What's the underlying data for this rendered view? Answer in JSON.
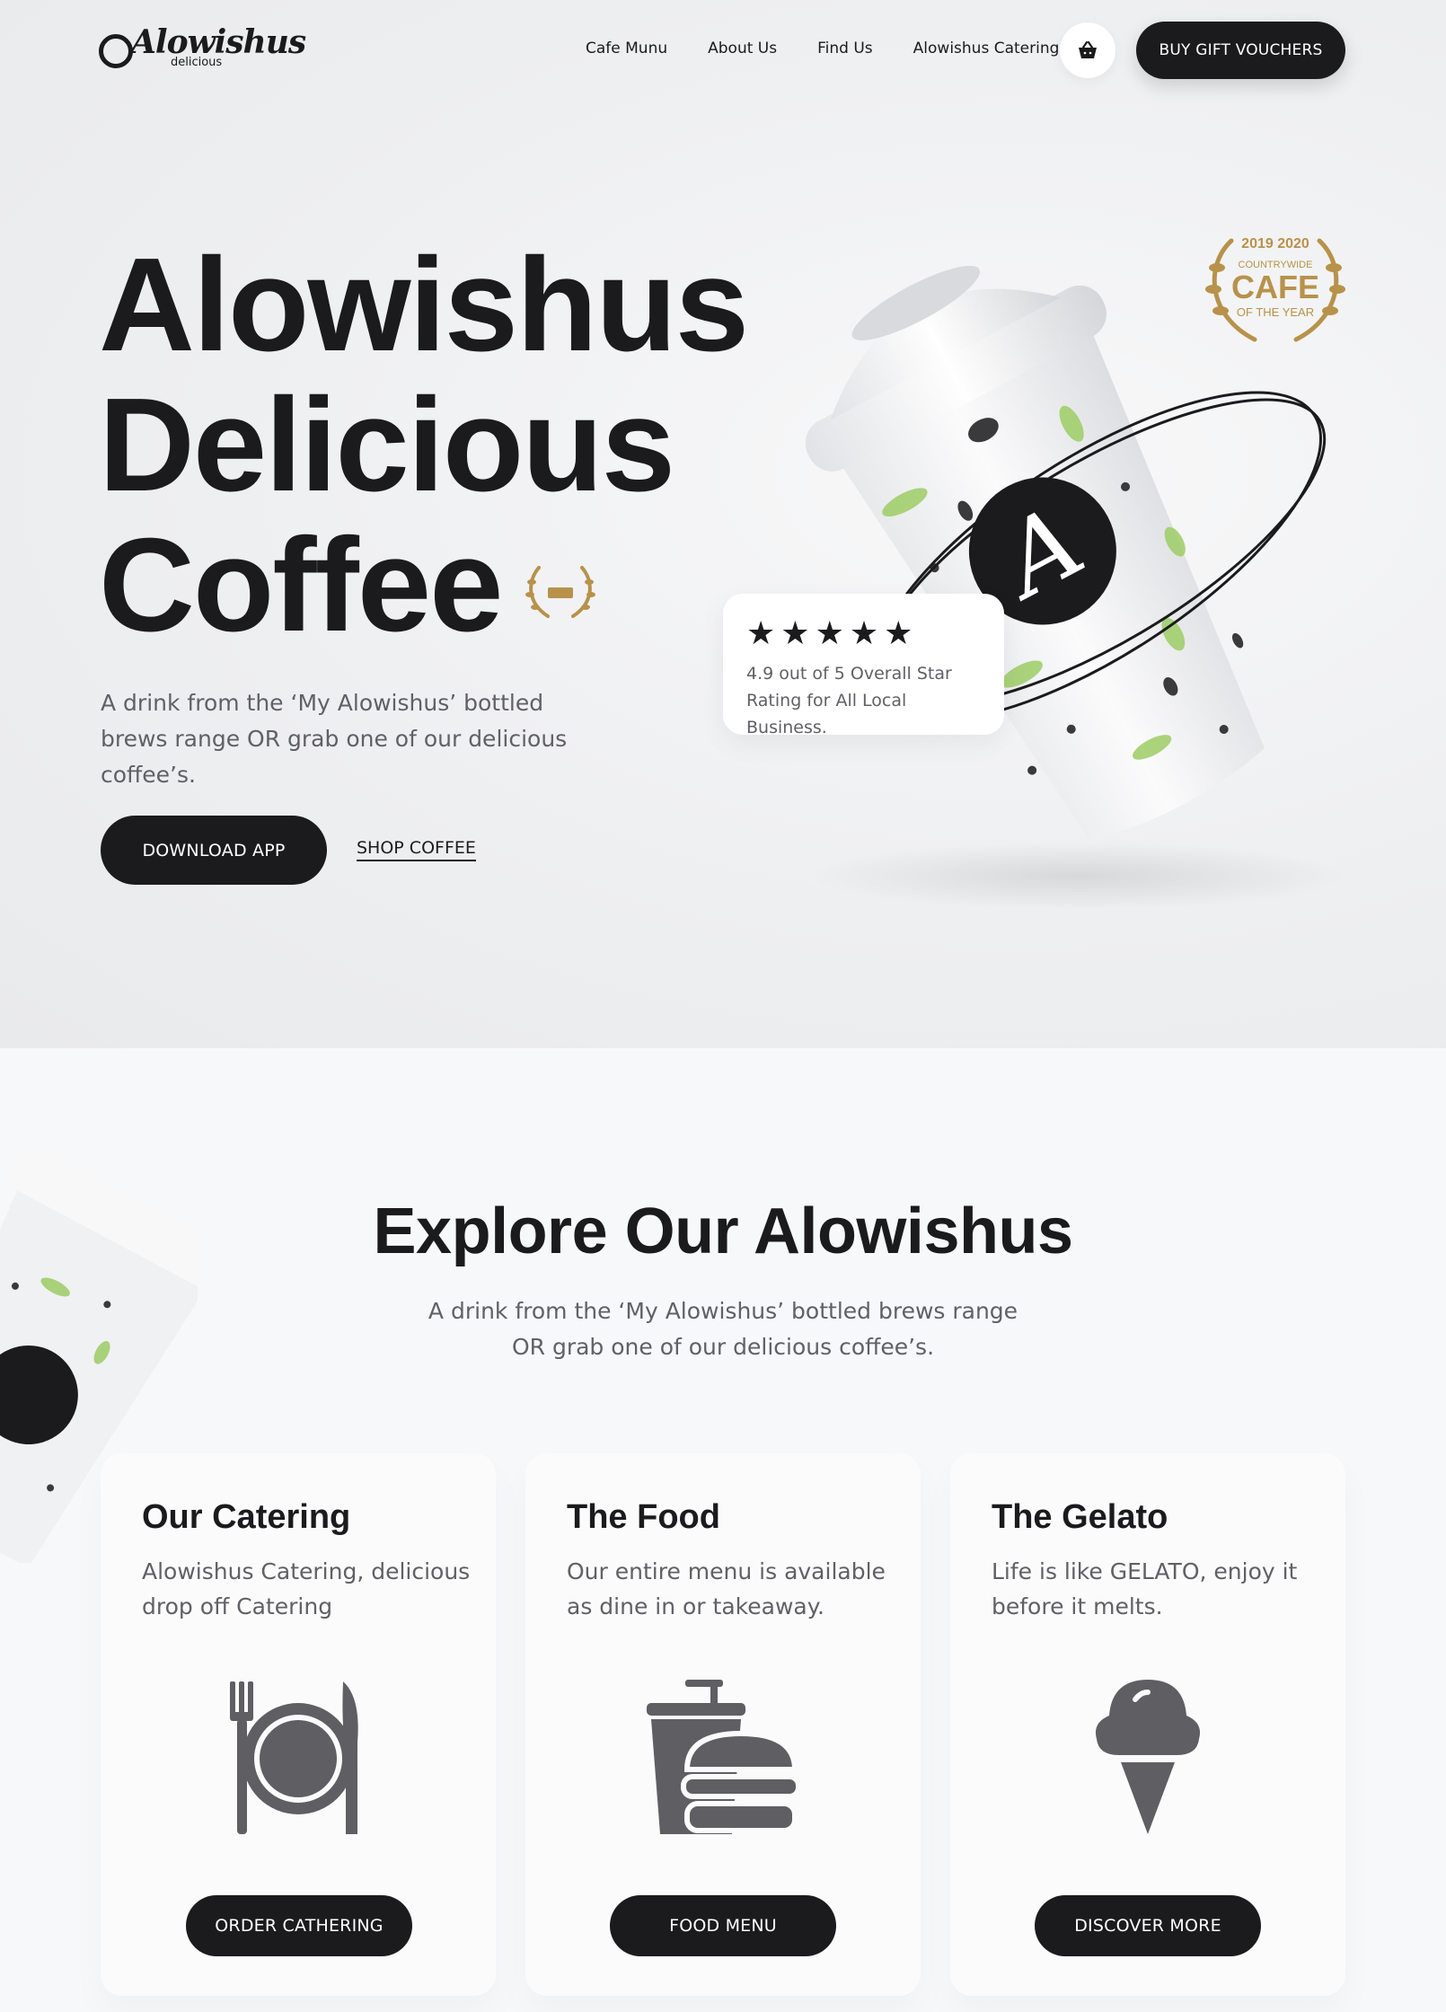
{
  "brand": {
    "logo_text": "Alowishus",
    "logo_sub": "delicious"
  },
  "nav": {
    "links": [
      "Cafe Munu",
      "About Us",
      "Find Us",
      "Alowishus Catering"
    ],
    "cart_icon": "basket-icon",
    "gift_button": "BUY GIFT VOUCHERS"
  },
  "hero": {
    "title_lines": [
      "Alowishus",
      "Delicious",
      "Coffee"
    ],
    "subtitle": "A drink from the ‘My Alowishus’ bottled brews range OR grab one of our delicious coffee’s.",
    "download_button": "DOWNLOAD APP",
    "shop_link": "SHOP COFFEE",
    "award": {
      "years": "2019 2020",
      "line": "COUNTRYWIDE",
      "big": "CAFE",
      "tag": "OF THE YEAR"
    },
    "rating": {
      "stars": 5,
      "text": "4.9 out of 5 Overall Star Rating for All Local Business."
    }
  },
  "explore": {
    "title": "Explore Our Alowishus",
    "subtitle": "A drink from the ‘My Alowishus’ bottled brews range OR grab one of our delicious coffee’s.",
    "cards": [
      {
        "title": "Our Catering",
        "desc": "Alowishus Catering, delicious drop off Catering",
        "icon": "plate-cutlery-icon",
        "button": "ORDER CATHERING"
      },
      {
        "title": "The Food",
        "desc": "Our entire menu is available as dine in or takeaway.",
        "icon": "drink-burger-icon",
        "button": "FOOD MENU"
      },
      {
        "title": "The Gelato",
        "desc": "Life is like GELATO, enjoy it before it melts.",
        "icon": "ice-cream-icon",
        "button": "DISCOVER MORE"
      }
    ]
  },
  "colors": {
    "dark": "#1b1b1d",
    "text_muted": "#606066",
    "leaf_green": "#9ccc65",
    "award_gold": "#b8924a"
  }
}
